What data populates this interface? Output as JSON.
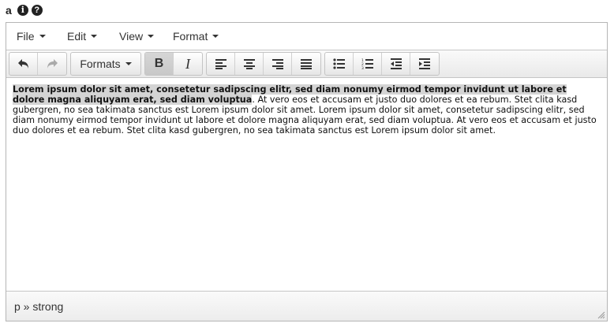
{
  "field": {
    "label": "a",
    "info_icon": "info-icon",
    "help_icon": "help-icon",
    "info_glyph": "i",
    "help_glyph": "?"
  },
  "menubar": {
    "file": "File",
    "edit": "Edit",
    "view": "View",
    "format": "Format"
  },
  "toolbar": {
    "undo_icon": "undo-icon",
    "redo_icon": "redo-icon",
    "formats_label": "Formats",
    "bold_label": "B",
    "italic_label": "I",
    "align_icons": [
      "align-left-icon",
      "align-center-icon",
      "align-right-icon",
      "align-justify-icon"
    ],
    "list_icons": [
      "bullet-list-icon",
      "numbered-list-icon",
      "outdent-icon",
      "indent-icon"
    ]
  },
  "content": {
    "selected_bold_text": "Lorem ipsum dolor sit amet, consetetur sadipscing elitr, sed diam nonumy eirmod tempor invidunt ut labore et dolore magna aliquyam erat, sed diam voluptua",
    "rest_text": ". At vero eos et accusam et justo duo dolores et ea rebum. Stet clita kasd gubergren, no sea takimata sanctus est Lorem ipsum dolor sit amet. Lorem ipsum dolor sit amet, consetetur sadipscing elitr, sed diam nonumy eirmod tempor invidunt ut labore et dolore magna aliquyam erat, sed diam voluptua. At vero eos et accusam et justo duo dolores et ea rebum. Stet clita kasd gubergren, no sea takimata sanctus est Lorem ipsum dolor sit amet."
  },
  "statusbar": {
    "path": "p » strong"
  },
  "colors": {
    "selection": "#d4d4d4",
    "border": "#b5b5b5",
    "active_button": "#c8c8c8"
  }
}
